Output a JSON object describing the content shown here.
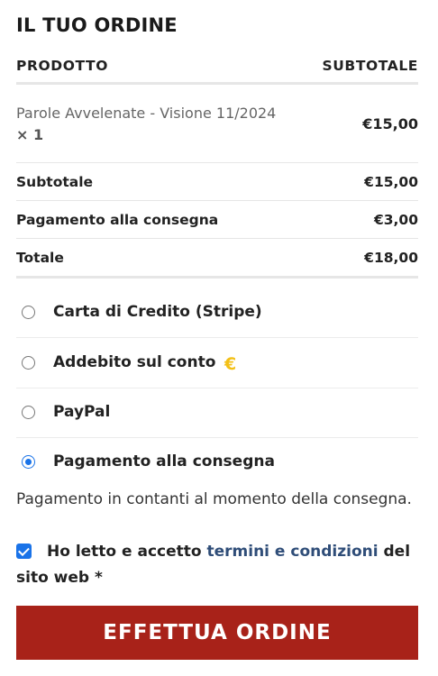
{
  "order": {
    "title": "IL TUO ORDINE",
    "col_product": "PRODOTTO",
    "col_subtotal": "SUBTOTALE",
    "item": {
      "name": "Parole Avvelenate - Visione 11/2024",
      "qty": "× 1",
      "price": "€15,00"
    },
    "subtotal": {
      "label": "Subtotale",
      "value": "€15,00"
    },
    "fee": {
      "label": "Pagamento alla consegna",
      "value": "€3,00"
    },
    "total": {
      "label": "Totale",
      "value": "€18,00"
    }
  },
  "payment": {
    "methods": [
      {
        "label": "Carta di Credito (Stripe)",
        "selected": false
      },
      {
        "label": "Addebito sul conto",
        "icon": "€",
        "selected": false
      },
      {
        "label": "PayPal",
        "selected": false
      },
      {
        "label": "Pagamento alla consegna",
        "selected": true
      }
    ],
    "description": "Pagamento in contanti al momento della consegna."
  },
  "terms": {
    "prefix": "Ho letto e accetto",
    "link": "termini e condizioni",
    "suffix": "del sito web *",
    "checked": true
  },
  "submit_label": "EFFETTUA ORDINE",
  "colors": {
    "accent": "#a82219",
    "radio": "#1a73e8",
    "link": "#2f4d78",
    "euro_icon": "#f3c016"
  }
}
